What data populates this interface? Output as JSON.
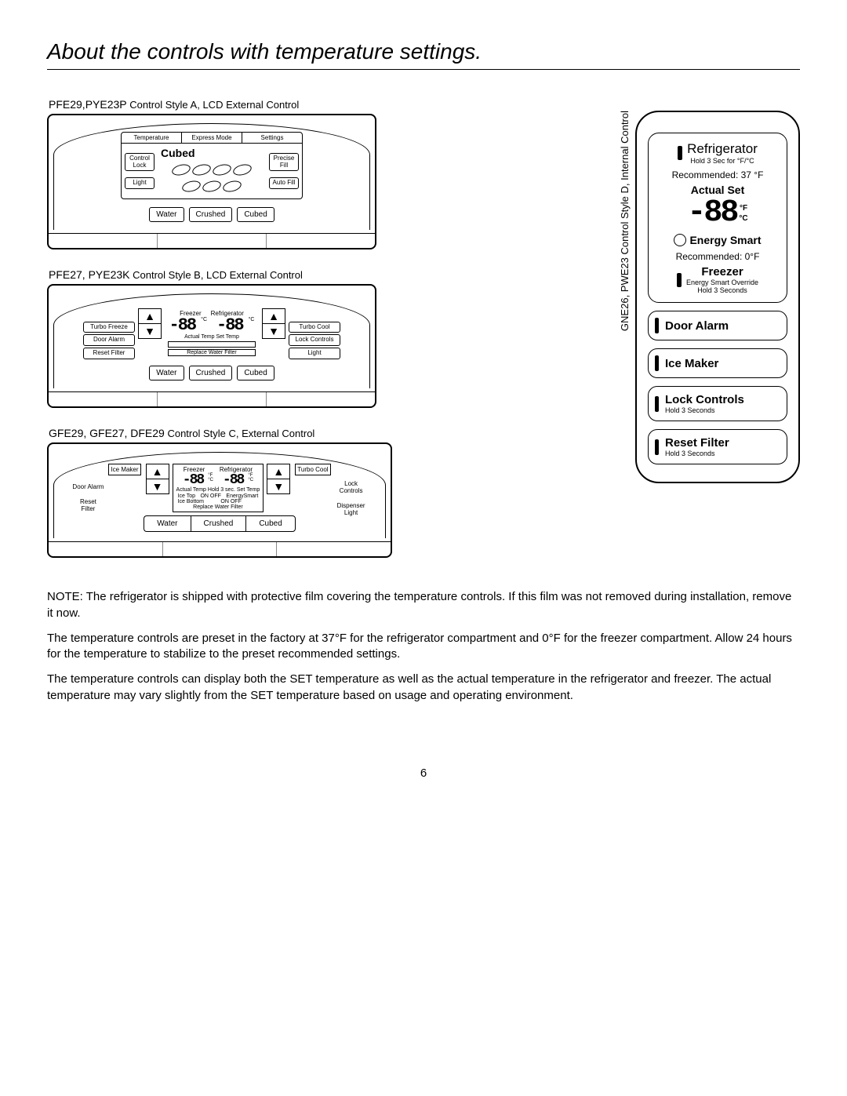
{
  "title": "About the controls with temperature settings.",
  "styleA": {
    "caption_model": "PFE29,PYE23P",
    "caption_rest": " Control Style A, LCD External Control",
    "tabs": [
      "Temperature",
      "Express Mode",
      "Settings"
    ],
    "left_buttons": [
      "Control Lock",
      "Light"
    ],
    "right_buttons": [
      "Precise Fill",
      "Auto Fill"
    ],
    "center_label": "Cubed",
    "bottom": [
      "Water",
      "Crushed",
      "Cubed"
    ]
  },
  "styleB": {
    "caption_model": "PFE27, PYE23K",
    "caption_rest": " Control Style B, LCD External Control",
    "freezer_label": "Freezer",
    "fridge_label": "Refrigerator",
    "seg": "-88",
    "unit_c": "°C",
    "sub1": "Actual Temp Set Temp",
    "left_btns": [
      "Turbo Freeze",
      "Door Alarm",
      "Reset Filter"
    ],
    "right_btns": [
      "Turbo Cool",
      "Lock Controls",
      "Light"
    ],
    "replace": "Replace Water Filter",
    "bottom": [
      "Water",
      "Crushed",
      "Cubed"
    ]
  },
  "styleC": {
    "caption_model": "GFE29, GFE27, DFE29",
    "caption_rest": " Control Style C, External Control",
    "left_labels": [
      "Door Alarm",
      "Reset Filter"
    ],
    "right_labels": [
      "Lock Controls",
      "Dispenser Light"
    ],
    "ice_maker": "Ice Maker",
    "turbo_cool": "Turbo Cool",
    "freezer": "Freezer",
    "fridge": "Refrigerator",
    "seg": "-88",
    "unit_f": "°F",
    "unit_c": "°C",
    "sub1": "Actual Temp Hold 3 sec. Set Temp",
    "ice_top": "Ice Top",
    "ice_bottom": "Ice Bottom",
    "onoff": "ON OFF",
    "energy": "EnergySmart",
    "replace": "Replace Water Filter",
    "bottom": [
      "Water",
      "Crushed",
      "Cubed"
    ]
  },
  "styleD": {
    "side_label": "GNE26, PWE23  Control Style D, Internal Control",
    "fridge": "Refrigerator",
    "hold_fc": "Hold 3 Sec for °F/°C",
    "rec_fridge": "Recommended: 37 °F",
    "actual_set": "Actual Set",
    "seg": "-88",
    "unit_f": "°F",
    "unit_c": "°C",
    "energy_smart": "Energy Smart",
    "rec_freezer": "Recommended: 0°F",
    "freezer": "Freezer",
    "override": "Energy Smart Override",
    "hold3": "Hold 3 Seconds",
    "items": [
      {
        "title": "Door Alarm",
        "sub": ""
      },
      {
        "title": "Ice Maker",
        "sub": ""
      },
      {
        "title": "Lock Controls",
        "sub": "Hold 3 Seconds"
      },
      {
        "title": "Reset Filter",
        "sub": "Hold 3 Seconds"
      }
    ]
  },
  "note": "NOTE: The refrigerator is shipped with protective film covering the temperature controls. If this film was not removed during installation, remove it now.",
  "para1": "The temperature controls are preset in the factory at 37°F for the refrigerator compartment and 0°F for the freezer compartment. Allow 24 hours for the temperature to stabilize to the preset recommended settings.",
  "para2": "The temperature controls can display both the SET temperature as well as the actual temperature in the refrigerator and freezer. The actual temperature may vary slightly from the SET temperature based on usage and operating environment.",
  "page": "6"
}
